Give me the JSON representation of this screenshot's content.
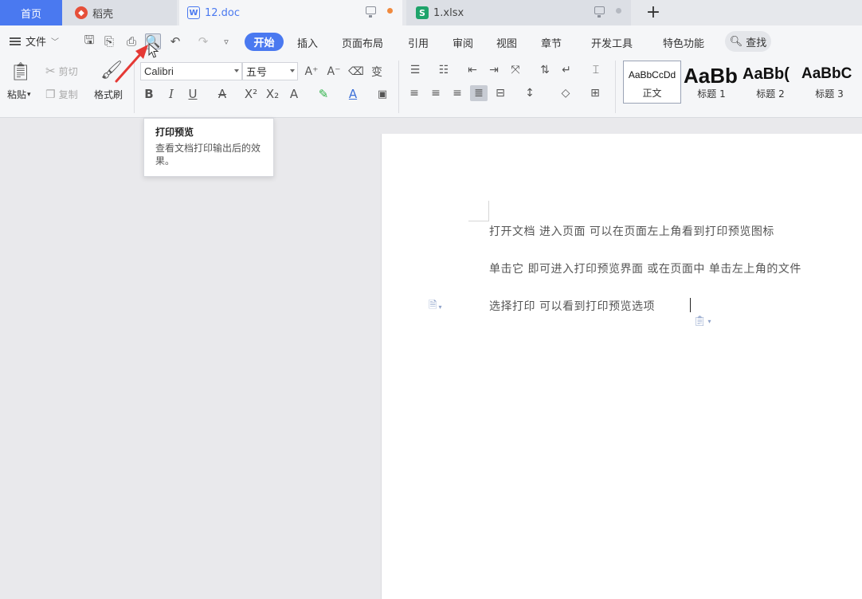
{
  "tabs": {
    "home": "首页",
    "daoke": "稻壳",
    "doc": "12.doc",
    "xls": "1.xlsx",
    "add": "+"
  },
  "menu": {
    "file": "文件",
    "start": "开始",
    "insert": "插入",
    "layout": "页面布局",
    "reference": "引用",
    "review": "审阅",
    "view": "视图",
    "chapter": "章节",
    "dev": "开发工具",
    "special": "特色功能",
    "search": "查找"
  },
  "ribbon": {
    "paste": "粘贴",
    "cut": "剪切",
    "copy": "复制",
    "format_painter": "格式刷",
    "font": "Calibri",
    "size": "五号",
    "styles": [
      {
        "sample": "AaBbCcDd",
        "label": "正文"
      },
      {
        "sample": "AaBb",
        "label": "标题 1"
      },
      {
        "sample": "AaBb(",
        "label": "标题 2"
      },
      {
        "sample": "AaBbC",
        "label": "标题 3"
      }
    ]
  },
  "tooltip": {
    "title": "打印预览",
    "desc": "查看文档打印输出后的效果。"
  },
  "document": {
    "lines": [
      "打开文档    进入页面    可以在页面左上角看到打印预览图标",
      "单击它    即可进入打印预览界面    或在页面中    单击左上角的文件",
      "选择打印    可以看到打印预览选项"
    ]
  },
  "colors": {
    "accent": "#4a79f0",
    "unsaved_dot": "#f08a3e",
    "annotation_arrow": "#e53935"
  }
}
